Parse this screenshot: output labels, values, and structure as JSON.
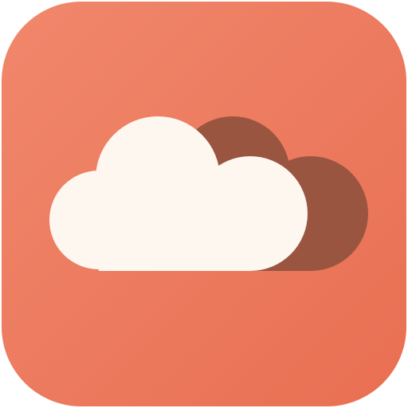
{
  "icon": {
    "name": "cloud-app-icon",
    "symbol": "cloud-icon",
    "colors": {
      "tile_light": "#F0876C",
      "tile_dark": "#E96F52",
      "cloud_front": "#FDF7F0",
      "cloud_back": "#9A5540"
    }
  }
}
